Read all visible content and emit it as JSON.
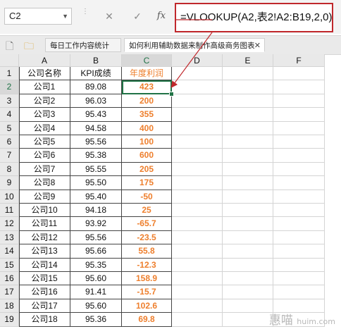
{
  "formula_bar": {
    "name_box": "C2",
    "cancel_glyph": "✕",
    "confirm_glyph": "✓",
    "fx_label": "fx",
    "formula": "=VLOOKUP(A2,表2!A2:B19,2,0)"
  },
  "tabs": [
    {
      "label": "每日工作内容统计",
      "active": false
    },
    {
      "label": "如何利用辅助数据来制作高级商务图表",
      "active": true
    }
  ],
  "columns": [
    "A",
    "B",
    "C",
    "D",
    "E",
    "F"
  ],
  "rows": [
    {
      "num": "1",
      "a": "公司名称",
      "b": "KPI成绩",
      "c": "年度利润"
    },
    {
      "num": "2",
      "a": "公司1",
      "b": "89.08",
      "c": "423"
    },
    {
      "num": "3",
      "a": "公司2",
      "b": "96.03",
      "c": "200"
    },
    {
      "num": "4",
      "a": "公司3",
      "b": "95.43",
      "c": "355"
    },
    {
      "num": "5",
      "a": "公司4",
      "b": "94.58",
      "c": "400"
    },
    {
      "num": "6",
      "a": "公司5",
      "b": "95.56",
      "c": "100"
    },
    {
      "num": "7",
      "a": "公司6",
      "b": "95.38",
      "c": "600"
    },
    {
      "num": "8",
      "a": "公司7",
      "b": "95.55",
      "c": "205"
    },
    {
      "num": "9",
      "a": "公司8",
      "b": "95.50",
      "c": "175"
    },
    {
      "num": "10",
      "a": "公司9",
      "b": "95.40",
      "c": "-50"
    },
    {
      "num": "11",
      "a": "公司10",
      "b": "94.18",
      "c": "25"
    },
    {
      "num": "12",
      "a": "公司11",
      "b": "93.92",
      "c": "-65.7"
    },
    {
      "num": "13",
      "a": "公司12",
      "b": "95.56",
      "c": "-23.5"
    },
    {
      "num": "14",
      "a": "公司13",
      "b": "95.66",
      "c": "55.8"
    },
    {
      "num": "15",
      "a": "公司14",
      "b": "95.35",
      "c": "-12.3"
    },
    {
      "num": "16",
      "a": "公司15",
      "b": "95.60",
      "c": "158.9"
    },
    {
      "num": "17",
      "a": "公司16",
      "b": "91.41",
      "c": "-15.7"
    },
    {
      "num": "18",
      "a": "公司17",
      "b": "95.60",
      "c": "102.6"
    },
    {
      "num": "19",
      "a": "公司18",
      "b": "95.36",
      "c": "69.8"
    }
  ],
  "active_cell": "C2",
  "accent_color": "#ee7f2d",
  "highlight_color": "#c0282c",
  "watermark": "惠喵",
  "watermark_url": "huim.com"
}
